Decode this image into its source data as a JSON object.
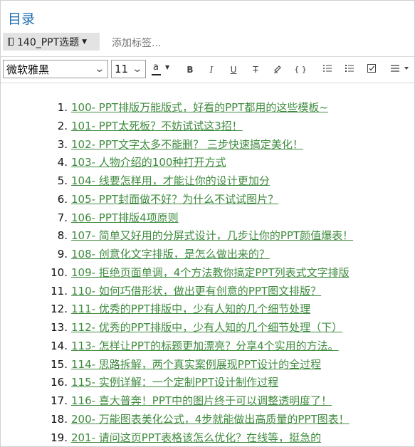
{
  "header": {
    "title": "目录"
  },
  "notebook": {
    "label": "140_PPT选题"
  },
  "tags": {
    "placeholder": "添加标签..."
  },
  "toolbar": {
    "font_family": "微软雅黑",
    "font_size": "11",
    "font_color_icon": "font-color-icon",
    "bold": "B",
    "italic": "I",
    "underline": "U",
    "strikethrough": "T",
    "code": "{ }"
  },
  "list": {
    "items": [
      {
        "num": "1.",
        "text": "100- PPT排版万能版式，好看的PPT都用的这些模板~"
      },
      {
        "num": "2.",
        "text": "101- PPT太死板？不妨试试这3招！"
      },
      {
        "num": "3.",
        "text": "102- PPT文字太多不能删？ 三步快速搞定美化！"
      },
      {
        "num": "4.",
        "text": "103- 人物介绍的100种打开方式"
      },
      {
        "num": "5.",
        "text": "104- 线要怎样用，才能让你的设计更加分"
      },
      {
        "num": "6.",
        "text": "105- PPT封面做不好？为什么不试试图片？"
      },
      {
        "num": "7.",
        "text": "106- PPT排版4项原则"
      },
      {
        "num": "8.",
        "text": "107- 简单又好用的分屏式设计，几步让你的PPT颜值爆表！"
      },
      {
        "num": "9.",
        "text": "108- 创意化文字排版，是怎么做出来的？"
      },
      {
        "num": "10.",
        "text": "109- 拒绝页面单调，4个方法教你搞定PPT列表式文字排版"
      },
      {
        "num": "11.",
        "text": "110- 如何巧借形状，做出更有创意的PPT图文排版？"
      },
      {
        "num": "12.",
        "text": "111- 优秀的PPT排版中，少有人知的几个细节处理"
      },
      {
        "num": "13.",
        "text": "112- 优秀的PPT排版中，少有人知的几个细节处理（下）"
      },
      {
        "num": "14.",
        "text": "113- 怎样让PPT的标题更加漂亮？分享4个实用的方法。"
      },
      {
        "num": "15.",
        "text": "114- 思路拆解，两个真实案例展现PPT设计的全过程"
      },
      {
        "num": "16.",
        "text": "115- 实例详解：一个定制PPT设计制作过程"
      },
      {
        "num": "17.",
        "text": "116- 喜大普奔！PPT中的图片终于可以调整透明度了！"
      },
      {
        "num": "18.",
        "text": "200- 万能图表美化公式，4步就能做出高质量的PPT图表！"
      },
      {
        "num": "19.",
        "text": "201- 请问这页PPT表格该怎么优化？在线等，挺急的"
      }
    ]
  },
  "colors": {
    "link": "#3f8b3f",
    "title": "#1f6fb2",
    "notebook_bg": "#e3e3e3"
  }
}
